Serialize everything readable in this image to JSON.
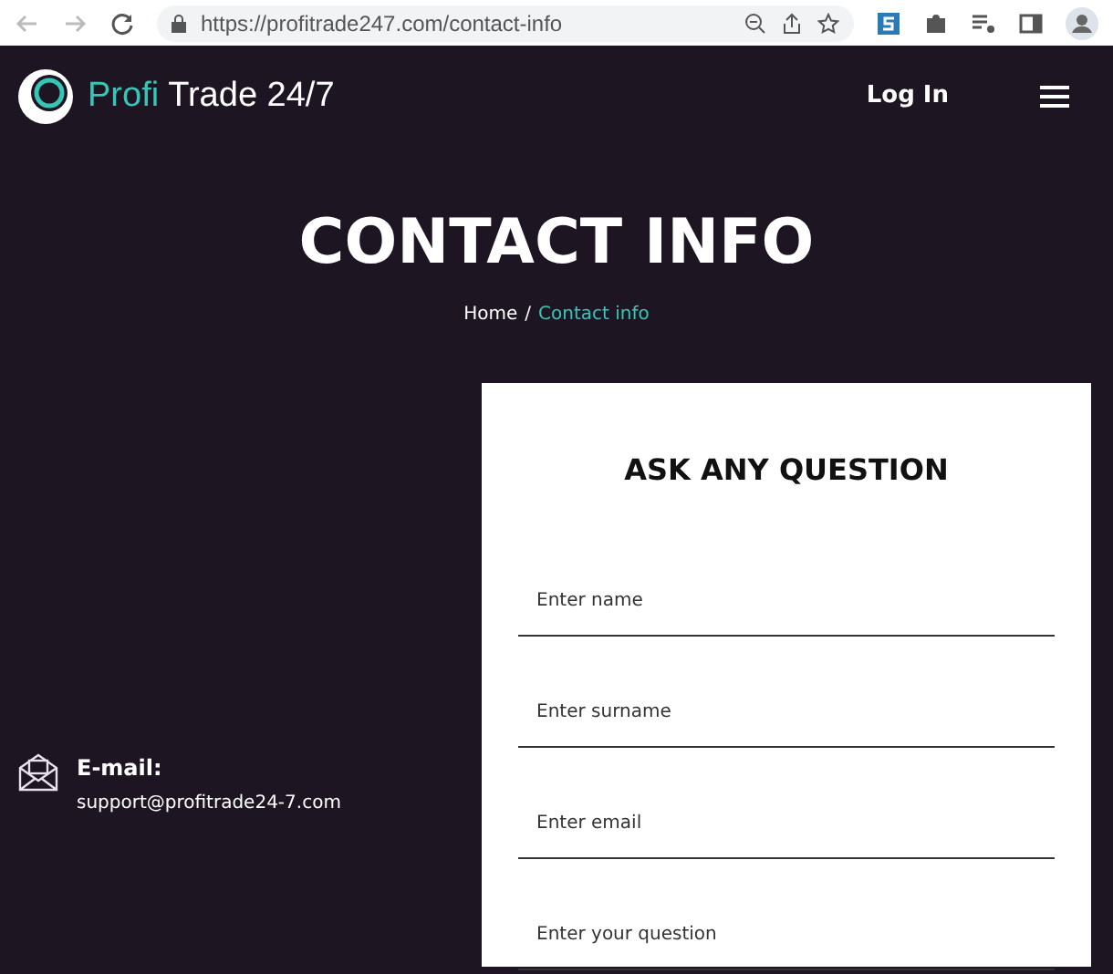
{
  "browser": {
    "url": "https://profitrade247.com/contact-info"
  },
  "header": {
    "logo_accent": "Profi",
    "logo_rest": "Trade 24/7",
    "login": "Log In"
  },
  "hero": {
    "title": "CONTACT INFO",
    "breadcrumb": [
      {
        "label": "Home",
        "selected": false
      },
      {
        "label": "Contact info",
        "selected": true
      }
    ],
    "separator": "/"
  },
  "contact": {
    "label": "E-mail:",
    "value": "support@profitrade24-7.com"
  },
  "form": {
    "title": "ASK ANY QUESTION",
    "fields": [
      {
        "placeholder": "Enter name"
      },
      {
        "placeholder": "Enter surname"
      },
      {
        "placeholder": "Enter email"
      },
      {
        "placeholder": "Enter your question"
      }
    ]
  }
}
